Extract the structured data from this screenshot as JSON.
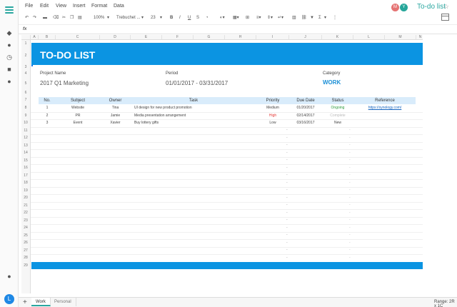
{
  "app": {
    "doc_title": "To-do list",
    "star_icon": "star-outline-icon",
    "collaborators": [
      {
        "initial": "M",
        "color": "#e57373"
      },
      {
        "initial": "Y",
        "color": "#26a69a"
      }
    ]
  },
  "menu": [
    "File",
    "Edit",
    "View",
    "Insert",
    "Format",
    "Data"
  ],
  "toolbar": {
    "zoom": "100%",
    "font": "Trebuchet ...",
    "font_size": "23",
    "bold": "B",
    "italic": "I",
    "underline": "U",
    "strike": "S",
    "sigma": "Σ"
  },
  "formula_bar": {
    "label": "fx",
    "value": ""
  },
  "columns": [
    "A",
    "B",
    "C",
    "D",
    "E",
    "F",
    "G",
    "H",
    "I",
    "J",
    "K",
    "L",
    "M",
    "N"
  ],
  "rows": [
    "1",
    "2",
    "3",
    "4",
    "5",
    "6",
    "7",
    "8",
    "9",
    "10",
    "11",
    "12",
    "13",
    "14",
    "15",
    "16",
    "17",
    "18",
    "19",
    "20",
    "21",
    "22",
    "23",
    "24",
    "25",
    "26",
    "27",
    "28",
    "29"
  ],
  "sheet": {
    "title": "TO-DO LIST",
    "project_name_label": "Project Name",
    "project_name": "2017 Q1 Marketing",
    "period_label": "Period",
    "period": "01/01/2017 - 03/31/2017",
    "category_label": "Category",
    "category": "WORK"
  },
  "table": {
    "headers": [
      "No.",
      "Subject",
      "Owner",
      "Task",
      "Priority",
      "Due Date",
      "Status",
      "Reference"
    ],
    "rows": [
      {
        "no": "1",
        "subject": "Website",
        "owner": "Tina",
        "task": "UI design for new product promotion",
        "priority": "Medium",
        "due": "01/20/2017",
        "status": "Ongoing",
        "reference": "https://synology.com/"
      },
      {
        "no": "2",
        "subject": "PR",
        "owner": "Jamie",
        "task": "Media presentation arrangement",
        "priority": "High",
        "due": "02/14/2017",
        "status": "Complete",
        "reference": ""
      },
      {
        "no": "3",
        "subject": "Event",
        "owner": "Xavier",
        "task": "Buy lottery gifts",
        "priority": "Low",
        "due": "03/16/2017",
        "status": "New",
        "reference": ""
      }
    ],
    "empty_placeholder": "-"
  },
  "tabs": [
    {
      "label": "Work",
      "active": true
    },
    {
      "label": "Personal",
      "active": false
    }
  ],
  "status": {
    "range": "Range: 2R x 1C"
  },
  "user_initial": "L",
  "colors": {
    "accent": "#0b94e2",
    "brand": "#2aa7a0",
    "header_fill": "#d9ecfb"
  }
}
